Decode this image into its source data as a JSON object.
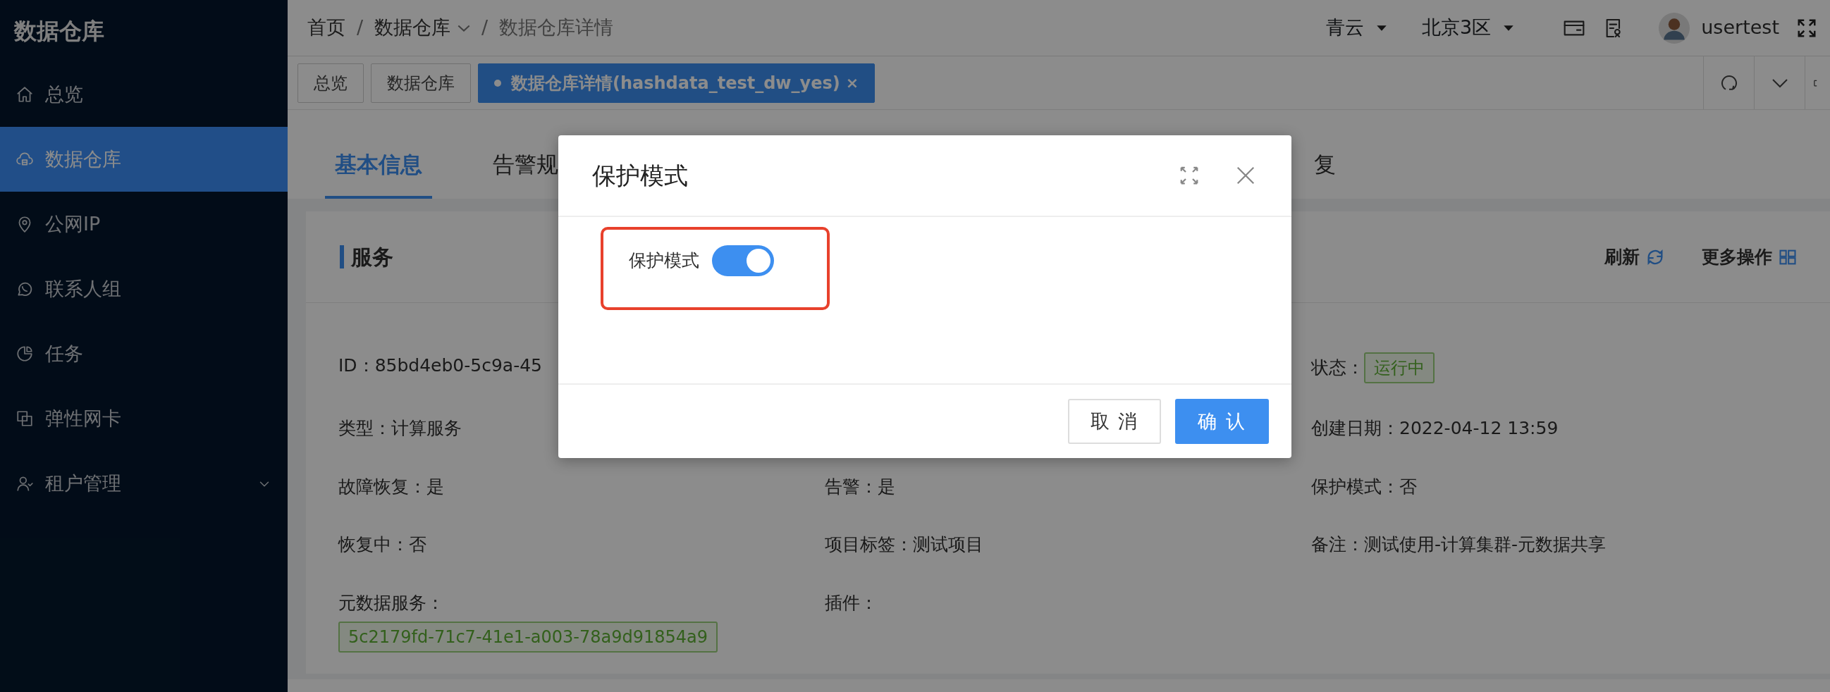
{
  "sidebar": {
    "title": "数据仓库",
    "items": [
      {
        "label": "总览",
        "selected": false
      },
      {
        "label": "数据仓库",
        "selected": true
      },
      {
        "label": "公网IP",
        "selected": false
      },
      {
        "label": "联系人组",
        "selected": false
      },
      {
        "label": "任务",
        "selected": false
      },
      {
        "label": "弹性网卡",
        "selected": false
      },
      {
        "label": "租户管理",
        "selected": false,
        "expanded": false
      }
    ]
  },
  "breadcrumb": {
    "separator": "/",
    "items": [
      {
        "label": "首页",
        "dropdown": false
      },
      {
        "label": "数据仓库",
        "dropdown": true
      },
      {
        "label": "数据仓库详情",
        "dropdown": false
      }
    ]
  },
  "header": {
    "cloud": "青云",
    "region": "北京3区",
    "user": "usertest"
  },
  "page_tabs": [
    {
      "label": "总览",
      "selected": false
    },
    {
      "label": "数据仓库",
      "selected": false
    },
    {
      "label": "数据仓库详情(hashdata_test_dw_yes)",
      "selected": true,
      "close": "×"
    }
  ],
  "detail_tabs": [
    {
      "label": "基本信息",
      "selected": true
    },
    {
      "label": "告警规",
      "selected": false
    },
    {
      "label": "复",
      "selected": false
    }
  ],
  "card": {
    "title": "服务",
    "actions": [
      {
        "label": "刷新"
      },
      {
        "label": "更多操作"
      }
    ],
    "rows": [
      [
        {
          "label": "ID：",
          "value": "85bd4eb0-5c9a-45",
          "kind": "text"
        },
        null,
        {
          "label": "状态：",
          "value": "运行中",
          "kind": "tag"
        }
      ],
      [
        {
          "label": "类型：",
          "value": "计算服务",
          "kind": "text"
        },
        null,
        {
          "label": "创建日期：",
          "value": "2022-04-12 13:59",
          "kind": "text"
        }
      ],
      [
        {
          "label": "故障恢复：",
          "value": "是",
          "kind": "text"
        },
        {
          "label": "告警：",
          "value": "是",
          "kind": "text"
        },
        {
          "label": "保护模式：",
          "value": "否",
          "kind": "text"
        }
      ],
      [
        {
          "label": "恢复中：",
          "value": "否",
          "kind": "text"
        },
        {
          "label": "项目标签：",
          "value": "测试项目",
          "kind": "text"
        },
        {
          "label": "备注：",
          "value": "测试使用-计算集群-元数据共享",
          "kind": "text"
        }
      ],
      [
        {
          "label": "元数据服务：",
          "value": "5c2179fd-71c7-41e1-a003-78a9d91854a9",
          "kind": "block-tag"
        },
        {
          "label": "插件："
        },
        null
      ]
    ]
  },
  "modal": {
    "title": "保护模式",
    "field": {
      "label": "保护模式",
      "on": true,
      "highlighted": true
    },
    "buttons": [
      {
        "label": "取 消",
        "kind": "secondary"
      },
      {
        "label": "确 认",
        "kind": "primary"
      }
    ]
  }
}
